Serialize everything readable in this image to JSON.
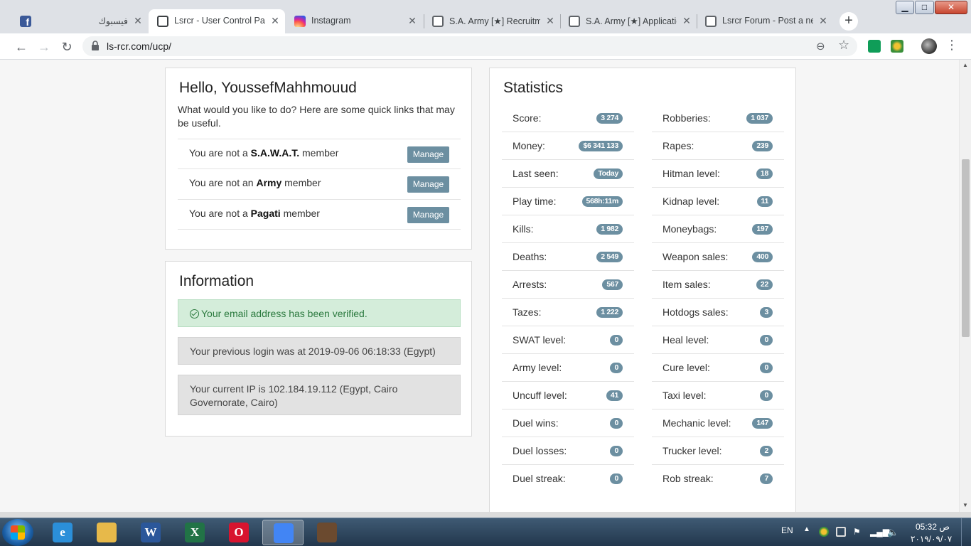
{
  "browser": {
    "tabs": [
      {
        "title": "فيسبوك",
        "favicon": "facebook-icon",
        "active": false
      },
      {
        "title": "Lsrcr - User Control Panel",
        "favicon": "lsrcr-icon",
        "active": true
      },
      {
        "title": "Instagram",
        "favicon": "instagram-icon",
        "active": false
      },
      {
        "title": "S.A. Army [★] Recruitment",
        "favicon": "globe-icon",
        "active": false
      },
      {
        "title": "S.A. Army [★] Applications",
        "favicon": "globe-icon",
        "active": false
      },
      {
        "title": "Lsrcr Forum - Post a new topic",
        "favicon": "globe-icon",
        "active": false
      }
    ],
    "url": "ls-rcr.com/ucp/",
    "icons": {
      "back": "back-arrow-icon",
      "forward": "forward-arrow-icon",
      "reload": "reload-icon",
      "lock": "lock-icon",
      "zoom": "zoom-icon",
      "bookmark": "star-icon",
      "menu": "kebab-menu-icon"
    }
  },
  "hello": {
    "title": "Hello, YoussefMahhmouud",
    "intro": "What would you like to do? Here are some quick links that may be useful.",
    "memberships": [
      {
        "prefix": "You are not a",
        "group": "S.A.W.A.T.",
        "suffix": "member",
        "button": "Manage"
      },
      {
        "prefix": "You are not an",
        "group": "Army",
        "suffix": "member",
        "button": "Manage"
      },
      {
        "prefix": "You are not a",
        "group": "Pagati",
        "suffix": "member",
        "button": "Manage"
      }
    ]
  },
  "information": {
    "title": "Information",
    "verified": "Your email address has been verified.",
    "previous_login": "Your previous login was at 2019-09-06 06:18:33 (Egypt)",
    "current_ip": "Your current IP is 102.184.19.112 (Egypt, Cairo Governorate, Cairo)"
  },
  "statistics": {
    "title": "Statistics",
    "left": [
      {
        "label": "Score:",
        "value": "3 274"
      },
      {
        "label": "Money:",
        "value": "$6 341 133"
      },
      {
        "label": "Last seen:",
        "value": "Today"
      },
      {
        "label": "Play time:",
        "value": "568h:11m"
      },
      {
        "label": "Kills:",
        "value": "1 982"
      },
      {
        "label": "Deaths:",
        "value": "2 549"
      },
      {
        "label": "Arrests:",
        "value": "567"
      },
      {
        "label": "Tazes:",
        "value": "1 222"
      },
      {
        "label": "SWAT level:",
        "value": "0"
      },
      {
        "label": "Army level:",
        "value": "0"
      },
      {
        "label": "Uncuff level:",
        "value": "41"
      },
      {
        "label": "Duel wins:",
        "value": "0"
      },
      {
        "label": "Duel losses:",
        "value": "0"
      },
      {
        "label": "Duel streak:",
        "value": "0"
      }
    ],
    "right": [
      {
        "label": "Robberies:",
        "value": "1 037"
      },
      {
        "label": "Rapes:",
        "value": "239"
      },
      {
        "label": "Hitman level:",
        "value": "18"
      },
      {
        "label": "Kidnap level:",
        "value": "11"
      },
      {
        "label": "Moneybags:",
        "value": "197"
      },
      {
        "label": "Weapon sales:",
        "value": "400"
      },
      {
        "label": "Item sales:",
        "value": "22"
      },
      {
        "label": "Hotdogs sales:",
        "value": "3"
      },
      {
        "label": "Heal level:",
        "value": "0"
      },
      {
        "label": "Cure level:",
        "value": "0"
      },
      {
        "label": "Taxi level:",
        "value": "0"
      },
      {
        "label": "Mechanic level:",
        "value": "147"
      },
      {
        "label": "Trucker level:",
        "value": "2"
      },
      {
        "label": "Rob streak:",
        "value": "7"
      }
    ]
  },
  "taskbar": {
    "apps": [
      {
        "name": "internet-explorer",
        "glyph": "e",
        "color": "#2b8fd9",
        "active": false
      },
      {
        "name": "file-explorer",
        "glyph": "",
        "color": "#e7b94a",
        "active": false
      },
      {
        "name": "microsoft-word",
        "glyph": "W",
        "color": "#2b579a",
        "active": false
      },
      {
        "name": "microsoft-excel",
        "glyph": "X",
        "color": "#217346",
        "active": false
      },
      {
        "name": "opera",
        "glyph": "O",
        "color": "#d8142f",
        "active": false
      },
      {
        "name": "google-chrome",
        "glyph": "",
        "color": "#4285f4",
        "active": true
      },
      {
        "name": "game-app",
        "glyph": "",
        "color": "#6b4a2f",
        "active": false
      }
    ],
    "language": "EN",
    "time": "05:32 ص",
    "date": "٢٠١٩/٠٩/٠٧"
  },
  "colors": {
    "badge": "#6c8fa1",
    "success_bg": "#d4edda",
    "success_text": "#2c7a3f"
  }
}
